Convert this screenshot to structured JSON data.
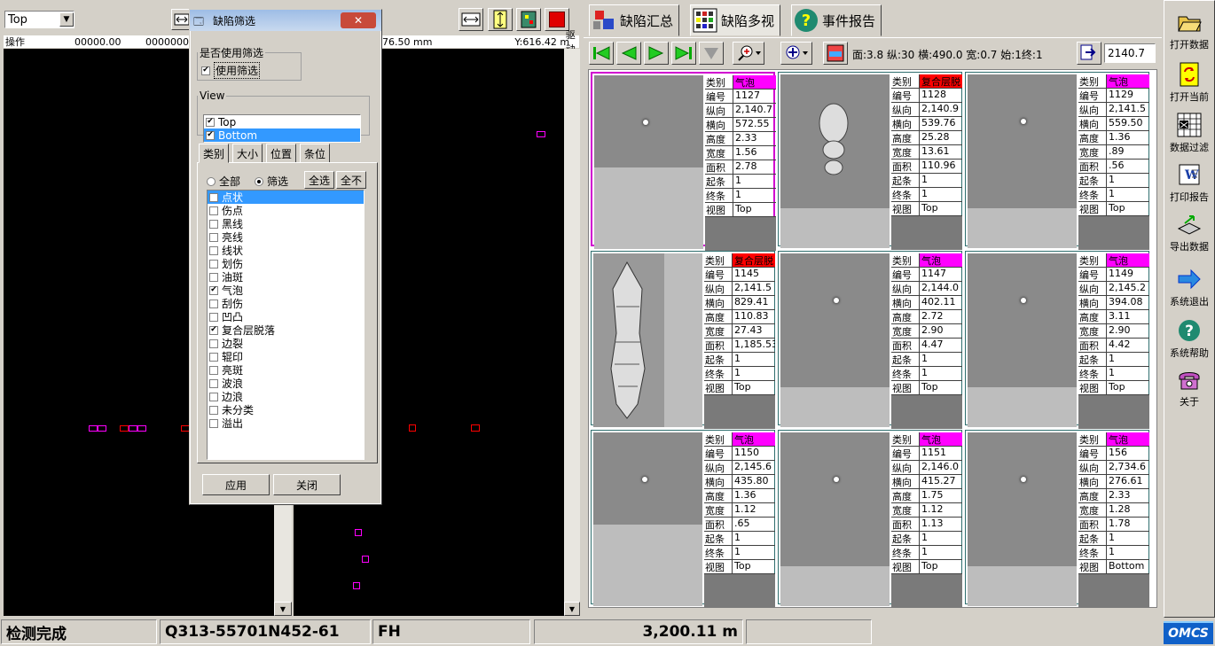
{
  "viewer": {
    "view_select": "Top",
    "ruler_left": [
      "操作",
      "00000.00",
      "0000000"
    ],
    "ruler_right": [
      "76.50 mm",
      "Y:616.42 m",
      "驱动"
    ]
  },
  "dialog": {
    "title": "缺陷筛选",
    "use_filter_group": "是否使用筛选",
    "use_filter": "使用筛选",
    "view_group": "View",
    "views": [
      {
        "label": "Top",
        "checked": true
      },
      {
        "label": "Bottom",
        "checked": true
      }
    ],
    "tabs": [
      "类别",
      "大小",
      "位置",
      "条位"
    ],
    "radio_all": "全部",
    "radio_filter": "筛选",
    "btn_select_all": "全选",
    "btn_select_none": "全不",
    "categories": [
      {
        "label": "点状",
        "checked": false
      },
      {
        "label": "伤点",
        "checked": false
      },
      {
        "label": "黑线",
        "checked": false
      },
      {
        "label": "亮线",
        "checked": false
      },
      {
        "label": "线状",
        "checked": false
      },
      {
        "label": "划伤",
        "checked": false
      },
      {
        "label": "油斑",
        "checked": false
      },
      {
        "label": "气泡",
        "checked": true
      },
      {
        "label": "刮伤",
        "checked": false
      },
      {
        "label": "凹凸",
        "checked": false
      },
      {
        "label": "复合层脱落",
        "checked": true
      },
      {
        "label": "边裂",
        "checked": false
      },
      {
        "label": "辊印",
        "checked": false
      },
      {
        "label": "亮斑",
        "checked": false
      },
      {
        "label": "波浪",
        "checked": false
      },
      {
        "label": "边浪",
        "checked": false
      },
      {
        "label": "未分类",
        "checked": false
      },
      {
        "label": "溢出",
        "checked": false
      }
    ],
    "btn_apply": "应用",
    "btn_close": "关闭"
  },
  "right": {
    "tabs": [
      "缺陷汇总",
      "缺陷多视",
      "事件报告"
    ],
    "toolbar_info": "面:3.8  纵:30  横:490.0  宽:0.7  始:1终:1",
    "position_value": "2140.7",
    "info_keys": [
      "类别",
      "编号",
      "纵向",
      "横向",
      "高度",
      "宽度",
      "面积",
      "起条",
      "终条",
      "视图"
    ],
    "cards": [
      {
        "type": "气泡",
        "color": "#ff00ff",
        "values": [
          "1127",
          "2,140.7",
          "572.55",
          "2.33",
          "1.56",
          "2.78",
          "1",
          "1",
          "Top"
        ]
      },
      {
        "type": "复合层脱",
        "color": "#ff0000",
        "values": [
          "1128",
          "2,140.9",
          "539.76",
          "25.28",
          "13.61",
          "110.96",
          "1",
          "1",
          "Top"
        ]
      },
      {
        "type": "气泡",
        "color": "#ff00ff",
        "values": [
          "1129",
          "2,141.5",
          "559.50",
          "1.36",
          ".89",
          ".56",
          "1",
          "1",
          "Top"
        ]
      },
      {
        "type": "复合层脱",
        "color": "#ff0000",
        "values": [
          "1145",
          "2,141.5",
          "829.41",
          "110.83",
          "27.43",
          "1,185.53",
          "1",
          "1",
          "Top"
        ]
      },
      {
        "type": "气泡",
        "color": "#ff00ff",
        "values": [
          "1147",
          "2,144.0",
          "402.11",
          "2.72",
          "2.90",
          "4.47",
          "1",
          "1",
          "Top"
        ]
      },
      {
        "type": "气泡",
        "color": "#ff00ff",
        "values": [
          "1149",
          "2,145.2",
          "394.08",
          "3.11",
          "2.90",
          "4.42",
          "1",
          "1",
          "Top"
        ]
      },
      {
        "type": "气泡",
        "color": "#ff00ff",
        "values": [
          "1150",
          "2,145.6",
          "435.80",
          "1.36",
          "1.12",
          ".65",
          "1",
          "1",
          "Top"
        ]
      },
      {
        "type": "气泡",
        "color": "#ff00ff",
        "values": [
          "1151",
          "2,146.0",
          "415.27",
          "1.75",
          "1.12",
          "1.13",
          "1",
          "1",
          "Top"
        ]
      },
      {
        "type": "气泡",
        "color": "#ff00ff",
        "values": [
          "156",
          "2,734.6",
          "276.61",
          "2.33",
          "1.28",
          "1.78",
          "1",
          "1",
          "Bottom"
        ]
      }
    ]
  },
  "sidebar": {
    "items": [
      "打开数据",
      "打开当前",
      "数据过滤",
      "打印报告",
      "导出数据",
      "系统退出",
      "系统帮助",
      "关于"
    ]
  },
  "status": {
    "state": "检测完成",
    "coil_id": "Q313-55701N452-61",
    "code": "FH",
    "length": "3,200.11 m",
    "logo": "OMCS"
  }
}
